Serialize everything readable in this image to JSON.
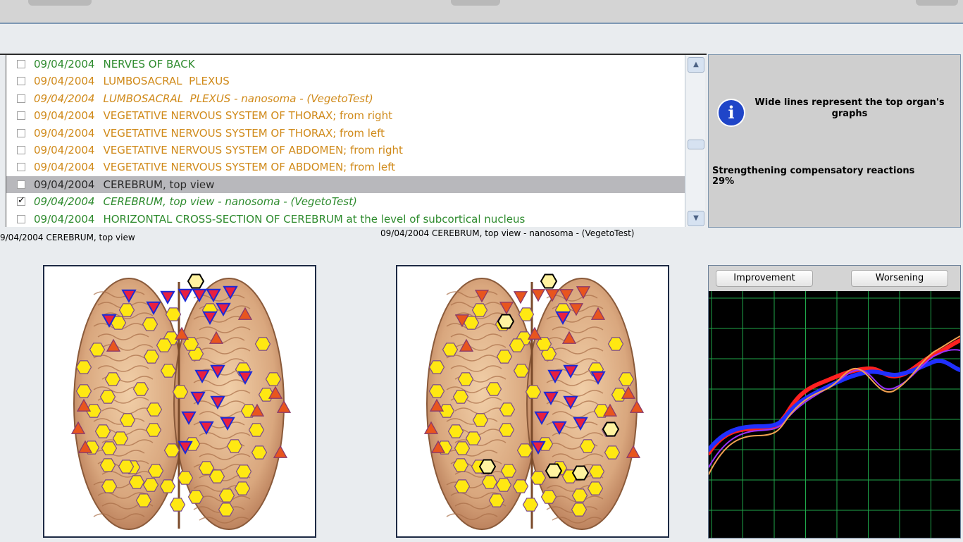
{
  "list": {
    "items": [
      {
        "date": "09/04/2004",
        "title": "NERVES OF BACK",
        "color": "#2e8b2e",
        "italic": false,
        "checked": false,
        "selected": false
      },
      {
        "date": "09/04/2004",
        "title": "LUMBOSACRAL  PLEXUS",
        "color": "#d08a1a",
        "italic": false,
        "checked": false,
        "selected": false
      },
      {
        "date": "09/04/2004",
        "title": "LUMBOSACRAL  PLEXUS - nanosoma - (VegetoTest)",
        "color": "#d08a1a",
        "italic": true,
        "checked": false,
        "selected": false
      },
      {
        "date": "09/04/2004",
        "title": "VEGETATIVE NERVOUS SYSTEM OF THORAX; from right",
        "color": "#d08a1a",
        "italic": false,
        "checked": false,
        "selected": false
      },
      {
        "date": "09/04/2004",
        "title": "VEGETATIVE NERVOUS SYSTEM OF THORAX; from left",
        "color": "#d08a1a",
        "italic": false,
        "checked": false,
        "selected": false
      },
      {
        "date": "09/04/2004",
        "title": "VEGETATIVE NERVOUS SYSTEM OF ABDOMEN; from right",
        "color": "#d08a1a",
        "italic": false,
        "checked": false,
        "selected": false
      },
      {
        "date": "09/04/2004",
        "title": "VEGETATIVE NERVOUS SYSTEM OF ABDOMEN; from left",
        "color": "#d08a1a",
        "italic": false,
        "checked": false,
        "selected": false
      },
      {
        "date": "09/04/2004",
        "title": "CEREBRUM, top view",
        "color": "#2a2a2a",
        "italic": false,
        "checked": false,
        "selected": true
      },
      {
        "date": "09/04/2004",
        "title": "CEREBRUM, top view - nanosoma - (VegetoTest)",
        "color": "#2e8b2e",
        "italic": true,
        "checked": true,
        "selected": false
      },
      {
        "date": "09/04/2004",
        "title": "HORIZONTAL CROSS-SECTION OF CEREBRUM at the level of subcortical nucleus",
        "color": "#2e8b2e",
        "italic": false,
        "checked": false,
        "selected": false
      }
    ]
  },
  "info": {
    "message": "Wide lines represent the top organ's graphs",
    "stat_label": "Strengthening compensatory reactions",
    "stat_value": "29%"
  },
  "captions": {
    "left": "9/04/2004  CEREBRUM, top view",
    "right": "09/04/2004  CEREBRUM, top view - nanosoma - (VegetoTest)"
  },
  "graph": {
    "improvement_label": "Improvement",
    "worsening_label": "Worsening"
  },
  "colors": {
    "triangle_fill": "#e8551e",
    "triangle_blue_fill": "#e82040",
    "triangle_blue_stroke": "#1a2ad8",
    "hex_fill": "#ffe812",
    "hex_pale_fill": "#fff3a0",
    "grid": "#1fa64a"
  }
}
